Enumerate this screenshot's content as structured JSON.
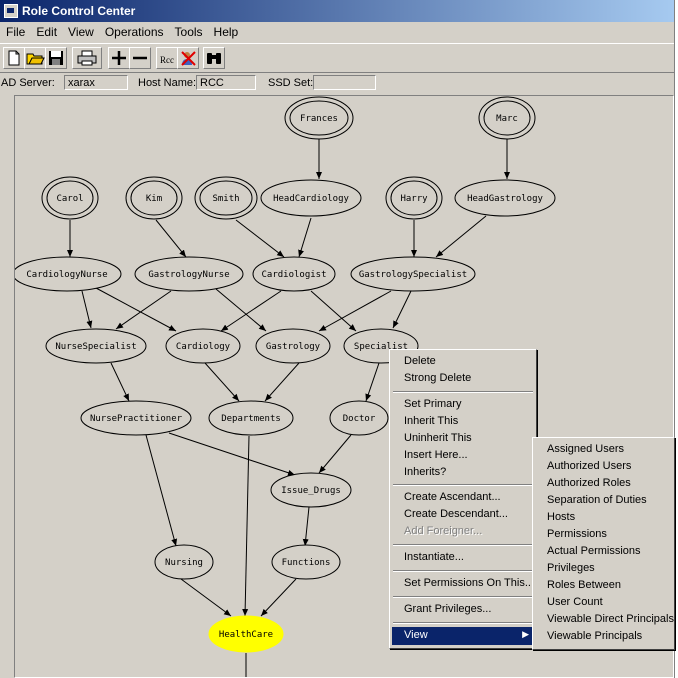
{
  "window": {
    "title": "Role Control Center"
  },
  "menu": [
    "File",
    "Edit",
    "View",
    "Operations",
    "Tools",
    "Help"
  ],
  "toolbar": {
    "icons": [
      "new-document-icon",
      "open-folder-icon",
      "save-icon",
      "print-icon",
      "plus-icon",
      "minus-icon",
      "rcc-icon",
      "delete-user-icon",
      "binoculars-icon"
    ],
    "rcc_label": "Rcc"
  },
  "fields": {
    "ad_server_label": "AD Server:",
    "ad_server_value": "xarax",
    "host_label": "Host Name:",
    "host_value": "RCC",
    "ssd_label": "SSD Set:",
    "ssd_value": ""
  },
  "graph": {
    "principals": [
      "Frances",
      "Marc",
      "Carol",
      "Kim",
      "Smith",
      "Harry"
    ],
    "roles": [
      "HeadCardiology",
      "HeadGastrology",
      "CardiologyNurse",
      "GastrologyNurse",
      "Cardiologist",
      "GastrologySpecialist",
      "NurseSpecialist",
      "Cardiology",
      "Gastrology",
      "Specialist",
      "NursePractitioner",
      "Departments",
      "Doctor",
      "Issue_Drugs",
      "Nursing",
      "Functions",
      "HealthCare"
    ],
    "highlight_color": "#ffff00"
  },
  "context_menu": {
    "items": [
      "Delete",
      "Strong Delete",
      "Set Primary",
      "Inherit This",
      "Uninherit This",
      "Insert Here...",
      "Inherits?",
      "Create Ascendant...",
      "Create Descendant...",
      "Add Foreigner...",
      "Instantiate...",
      "Set Permissions On This...",
      "Grant Privileges...",
      "View"
    ],
    "disabled": [
      "Add Foreigner..."
    ]
  },
  "submenu": {
    "items": [
      "Assigned Users",
      "Authorized Users",
      "Authorized Roles",
      "Separation of Duties",
      "Hosts",
      "Permissions",
      "Actual Permissions",
      "Privileges",
      "Roles Between",
      "User Count",
      "Viewable Direct Principals",
      "Viewable Principals"
    ]
  }
}
